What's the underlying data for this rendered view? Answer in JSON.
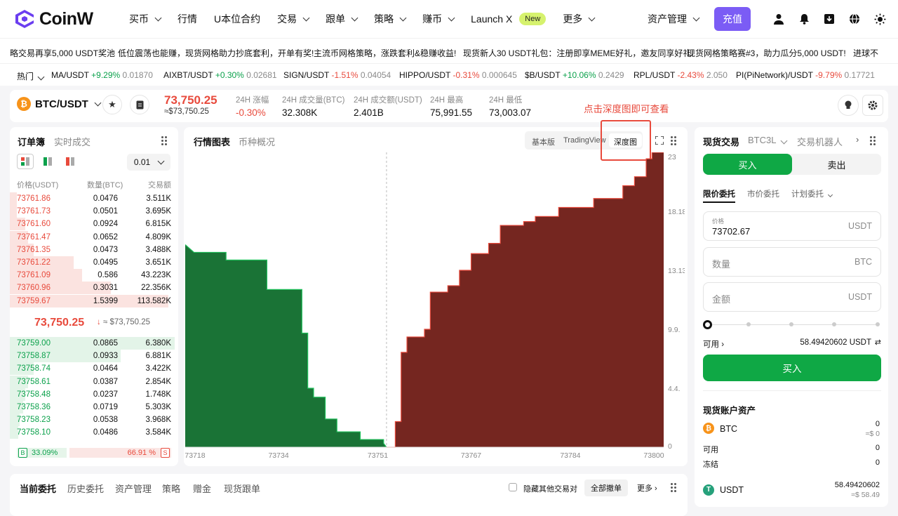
{
  "nav": {
    "logo": "CoinW",
    "items": [
      {
        "label": "买币",
        "chevron": true
      },
      {
        "label": "行情",
        "chevron": false
      },
      {
        "label": "U本位合约",
        "chevron": false
      },
      {
        "label": "交易",
        "chevron": true
      },
      {
        "label": "跟单",
        "chevron": true
      },
      {
        "label": "策略",
        "chevron": true
      },
      {
        "label": "赚币",
        "chevron": true
      },
      {
        "label": "Launch X",
        "chevron": false,
        "badge": "New"
      },
      {
        "label": "更多",
        "chevron": true
      }
    ],
    "asset_mgmt": "资产管理",
    "deposit": "充值"
  },
  "notices": [
    "略交易再享5,000 USDT奖池",
    "低位震荡也能赚，现货网格助力抄底套利，开单有奖!",
    "主流币网格策略，涨跌套利&稳赚收益!",
    "现货新人30 USDT礼包：注册即享MEME好礼，邀友同享好礼!",
    "现货网格策略赛#3，助力瓜分5,000 USDT!",
    "进球不"
  ],
  "market": {
    "hot_label": "热门",
    "items": [
      {
        "sym": "MA/USDT",
        "chg": "+9.29%",
        "price": "0.01870",
        "dir": "up"
      },
      {
        "sym": "AIXBT/USDT",
        "chg": "+0.30%",
        "price": "0.02681",
        "dir": "up"
      },
      {
        "sym": "SIGN/USDT",
        "chg": "-1.51%",
        "price": "0.04054",
        "dir": "down"
      },
      {
        "sym": "HIPPO/USDT",
        "chg": "-0.31%",
        "price": "0.000645",
        "dir": "down"
      },
      {
        "sym": "$B/USDT",
        "chg": "+10.06%",
        "price": "0.2429",
        "dir": "up"
      },
      {
        "sym": "RPL/USDT",
        "chg": "-2.43%",
        "price": "2.050",
        "dir": "down"
      },
      {
        "sym": "PI(PiNetwork)/USDT",
        "chg": "-9.79%",
        "price": "0.17721",
        "dir": "down"
      }
    ]
  },
  "symbol": {
    "pair": "BTC/USDT",
    "coin": "₿",
    "price": "73,750.25",
    "price_usd": "≈$73,750.25",
    "stats": [
      {
        "label": "24H 涨幅",
        "value": "-0.30%"
      },
      {
        "label": "24H 成交量(BTC)",
        "value": "32.308K"
      },
      {
        "label": "24H 成交额(USDT)",
        "value": "2.401B"
      },
      {
        "label": "24H 最高",
        "value": "75,991.55"
      },
      {
        "label": "24H 最低",
        "value": "73,003.07"
      }
    ],
    "hint": "点击深度图即可查看"
  },
  "orderbook": {
    "tab_active": "订单簿",
    "tab_other": "实时成交",
    "precision": "0.01",
    "headers": [
      "价格(USDT)",
      "数量(BTC)",
      "交易额"
    ],
    "asks": [
      {
        "p": "73761.86",
        "q": "0.0476",
        "t": "3.511K",
        "depth": 0.04
      },
      {
        "p": "73761.73",
        "q": "0.0501",
        "t": "3.695K",
        "depth": 0.04
      },
      {
        "p": "73761.60",
        "q": "0.0924",
        "t": "6.815K",
        "depth": 0.09
      },
      {
        "p": "73761.47",
        "q": "0.0652",
        "t": "4.809K",
        "depth": 0.11
      },
      {
        "p": "73761.35",
        "q": "0.0473",
        "t": "3.488K",
        "depth": 0.14
      },
      {
        "p": "73761.22",
        "q": "0.0495",
        "t": "3.651K",
        "depth": 0.38
      },
      {
        "p": "73761.09",
        "q": "0.586",
        "t": "43.223K",
        "depth": 0.43
      },
      {
        "p": "73760.96",
        "q": "0.3031",
        "t": "22.356K",
        "depth": 0.6
      },
      {
        "p": "73759.67",
        "q": "1.5399",
        "t": "113.582K",
        "depth": 0.94
      }
    ],
    "mid_price": "73,750.25",
    "mid_usd": "≈ $73,750.25",
    "bids": [
      {
        "p": "73759.00",
        "q": "0.0865",
        "t": "6.380K",
        "depth": 0.98
      },
      {
        "p": "73758.87",
        "q": "0.0933",
        "t": "6.881K",
        "depth": 0.66
      },
      {
        "p": "73758.74",
        "q": "0.0464",
        "t": "3.422K",
        "depth": 0.14
      },
      {
        "p": "73758.61",
        "q": "0.0387",
        "t": "2.854K",
        "depth": 0.11
      },
      {
        "p": "73758.48",
        "q": "0.0237",
        "t": "1.748K",
        "depth": 0.09
      },
      {
        "p": "73758.36",
        "q": "0.0719",
        "t": "5.303K",
        "depth": 0.08
      },
      {
        "p": "73758.23",
        "q": "0.0538",
        "t": "3.968K",
        "depth": 0.06
      },
      {
        "p": "73758.10",
        "q": "0.0486",
        "t": "3.584K",
        "depth": 0.05
      }
    ],
    "buy_pct": "33.09%",
    "sell_pct": "66.91 %",
    "buy_tag": "B",
    "sell_tag": "S",
    "buy_ratio": 0.3309
  },
  "chart": {
    "tab_active": "行情图表",
    "tab_other": "币种概况",
    "modes": [
      "基本版",
      "TradingView",
      "深度图"
    ],
    "active_mode": "深度图",
    "x_ticks": [
      "73718",
      "73734",
      "73751",
      "73767",
      "73784",
      "73800"
    ],
    "y_ticks": [
      "23",
      "18.18.",
      "13.13.",
      "9.9.",
      "4.4.",
      "0"
    ]
  },
  "chart_data": {
    "type": "area",
    "x_range": [
      73718,
      73800
    ],
    "y_range": [
      0,
      23
    ],
    "series": [
      {
        "side": "bid",
        "color": "#0e6b2b",
        "points": [
          [
            73718,
            15.8
          ],
          [
            73719.5,
            15.2
          ],
          [
            73725,
            15.2
          ],
          [
            73725,
            14.6
          ],
          [
            73732,
            14.6
          ],
          [
            73732,
            12.3
          ],
          [
            73738,
            12.3
          ],
          [
            73738,
            8.9
          ],
          [
            73739,
            8.9
          ],
          [
            73739,
            4.6
          ],
          [
            73740,
            4.6
          ],
          [
            73740,
            3.9
          ],
          [
            73742,
            3.9
          ],
          [
            73742,
            2.2
          ],
          [
            73744,
            2.2
          ],
          [
            73744,
            1.2
          ],
          [
            73748,
            1.2
          ],
          [
            73748,
            0.6
          ],
          [
            73752,
            0.6
          ],
          [
            73752,
            0.3
          ],
          [
            73752.5,
            0
          ]
        ]
      },
      {
        "side": "ask",
        "color": "#6e1a14",
        "points": [
          [
            73752.5,
            0
          ],
          [
            73754,
            0
          ],
          [
            73754,
            2.0
          ],
          [
            73755,
            2.0
          ],
          [
            73755,
            7.4
          ],
          [
            73756,
            7.4
          ],
          [
            73756,
            8.6
          ],
          [
            73759,
            8.6
          ],
          [
            73759,
            9.2
          ],
          [
            73760,
            9.2
          ],
          [
            73760,
            12.1
          ],
          [
            73763,
            12.1
          ],
          [
            73763,
            12.6
          ],
          [
            73765,
            12.6
          ],
          [
            73765,
            13.8
          ],
          [
            73767,
            13.8
          ],
          [
            73767,
            15.1
          ],
          [
            73770,
            15.1
          ],
          [
            73770,
            15.9
          ],
          [
            73772,
            15.9
          ],
          [
            73772,
            17.3
          ],
          [
            73776,
            17.3
          ],
          [
            73776,
            17.6
          ],
          [
            73778,
            17.6
          ],
          [
            73778,
            18.0
          ],
          [
            73782,
            18.0
          ],
          [
            73782,
            18.7
          ],
          [
            73788,
            18.7
          ],
          [
            73788,
            19.4
          ],
          [
            73793,
            19.4
          ],
          [
            73793,
            20.4
          ],
          [
            73795,
            20.4
          ],
          [
            73795,
            21.1
          ],
          [
            73797,
            21.1
          ],
          [
            73797,
            22.5
          ],
          [
            73798,
            22.5
          ],
          [
            73798,
            23
          ],
          [
            73800,
            23
          ]
        ]
      }
    ]
  },
  "trade": {
    "title": "现货交易",
    "sub1": "BTC3L",
    "sub2": "交易机器人",
    "buy_tab": "买入",
    "sell_tab": "卖出",
    "order_types": [
      "限价委托",
      "市价委托",
      "计划委托"
    ],
    "price_label": "价格",
    "price_value": "73702.67",
    "price_unit": "USDT",
    "qty_placeholder": "数量",
    "qty_unit": "BTC",
    "amount_placeholder": "金额",
    "amount_unit": "USDT",
    "available_label": "可用",
    "available_value": "58.49420602 USDT",
    "buy_button": "买入",
    "assets_title": "现货账户资产",
    "btc_name": "BTC",
    "btc_total": "0",
    "btc_usd": "≈$ 0",
    "btc_avail_label": "可用",
    "btc_avail": "0",
    "btc_frozen_label": "冻结",
    "btc_frozen": "0",
    "usdt_name": "USDT",
    "usdt_total": "58.49420602",
    "usdt_usd": "≈$ 58.49"
  },
  "bottom": {
    "tabs": [
      "当前委托",
      "历史委托",
      "资产管理",
      "策略",
      "赠金",
      "现货跟单"
    ],
    "hide_other": "隐藏其他交易对",
    "cancel_all": "全部撤单",
    "more": "更多"
  },
  "colors": {
    "accent": "#7b5cf5",
    "up": "#0ba14b",
    "down": "#e84a3c",
    "new_badge": "#d6f26e"
  }
}
